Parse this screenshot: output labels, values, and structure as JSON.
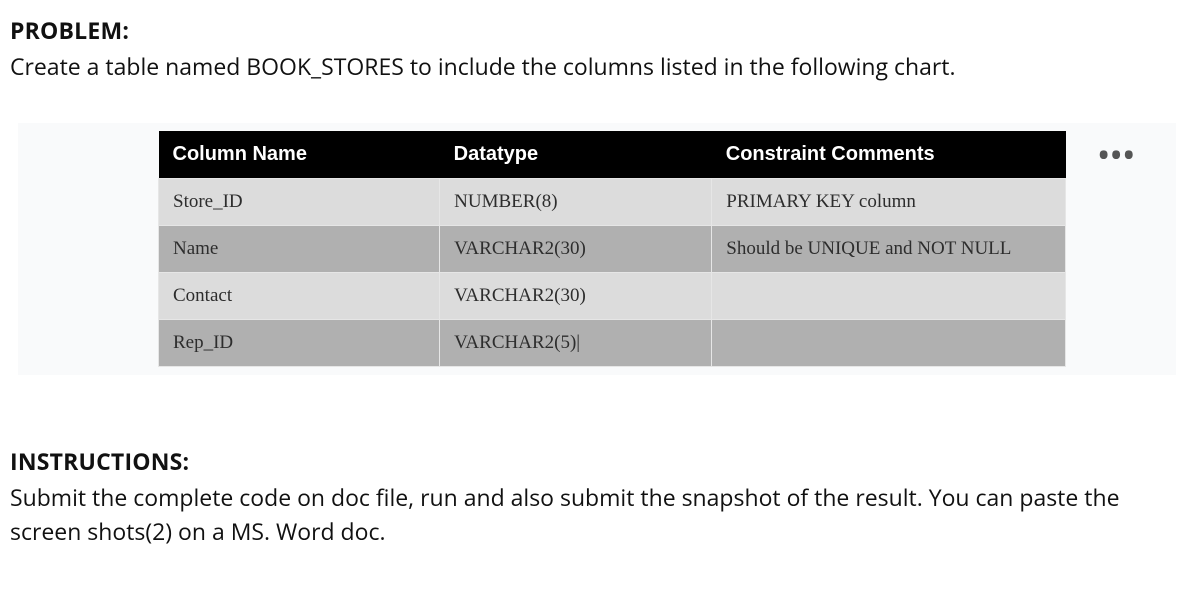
{
  "problem": {
    "heading": "PROBLEM:",
    "text": "Create a table named BOOK_STORES to include the columns listed in the following chart."
  },
  "chart_data": {
    "type": "table",
    "headers": [
      "Column Name",
      "Datatype",
      "Constraint Comments"
    ],
    "rows": [
      {
        "column_name": "Store_ID",
        "datatype": "NUMBER(8)",
        "constraint": "PRIMARY KEY column"
      },
      {
        "column_name": "Name",
        "datatype": "VARCHAR2(30)",
        "constraint": "Should be UNIQUE and NOT NULL"
      },
      {
        "column_name": "Contact",
        "datatype": "VARCHAR2(30)",
        "constraint": ""
      },
      {
        "column_name": "Rep_ID",
        "datatype": "VARCHAR2(5)|",
        "constraint": ""
      }
    ]
  },
  "ellipsis_label": "•••",
  "instructions": {
    "heading": "INSTRUCTIONS:",
    "text": "Submit the complete code on doc file, run and also submit the snapshot of the result. You can paste the screen shots(2) on a MS. Word doc."
  }
}
